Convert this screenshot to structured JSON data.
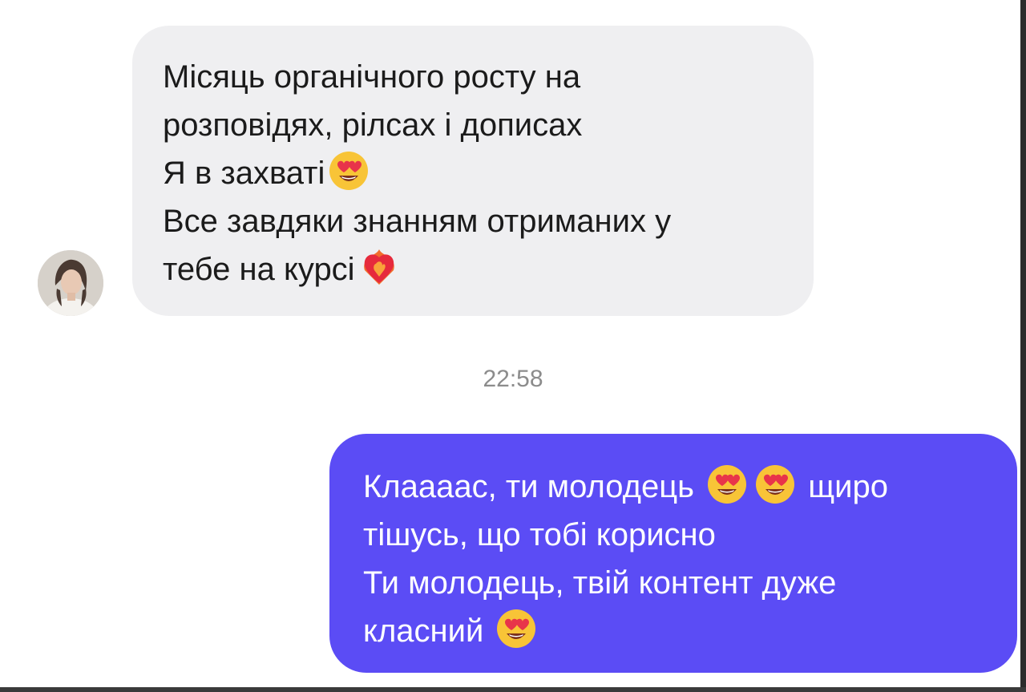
{
  "conversation": {
    "incoming": {
      "avatar_icon": "user-avatar",
      "lines": [
        "Місяць органічного росту на",
        "розповідях, рілсах і дописах",
        "Я в захваті",
        "Все завдяки знанням отриманих у",
        "тебе на курсі"
      ],
      "emoji": {
        "line3": "heart-eyes-emoji",
        "line5": "heart-on-fire-emoji"
      }
    },
    "timestamp": "22:58",
    "outgoing": {
      "lines": [
        "Клаааас, ти молодець",
        "щиро",
        "тішусь, що тобі корисно",
        "Ти молодець, твій контент дуже",
        "класний"
      ],
      "emoji": {
        "line1": [
          "heart-eyes-emoji",
          "heart-eyes-emoji"
        ],
        "line4": "heart-eyes-emoji"
      }
    }
  },
  "colors": {
    "incoming_bubble": "#efeff1",
    "outgoing_bubble": "#5b4cf5",
    "timestamp_text": "#8c8c8c"
  }
}
